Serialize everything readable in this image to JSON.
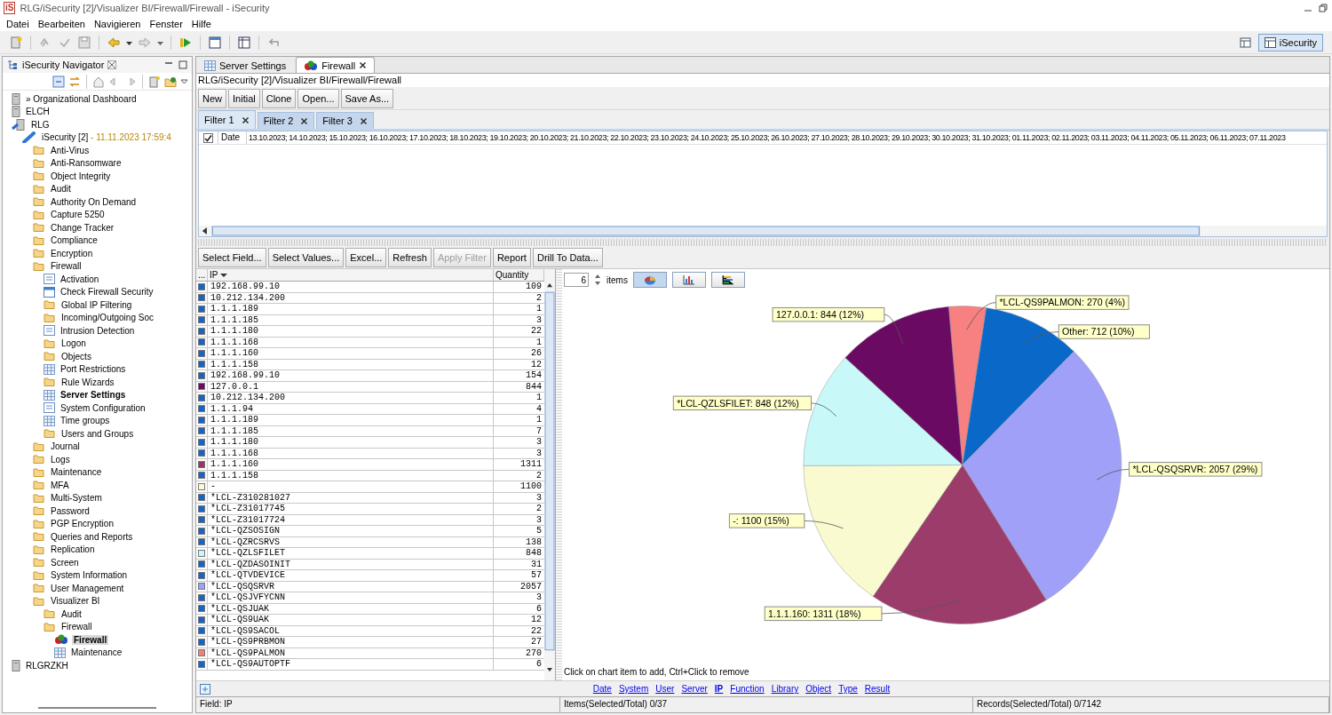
{
  "window": {
    "logo": "iS",
    "title": "RLG/iSecurity [2]/Visualizer BI/Firewall/Firewall - iSecurity"
  },
  "menu": [
    "Datei",
    "Bearbeiten",
    "Navigieren",
    "Fenster",
    "Hilfe"
  ],
  "perspective": {
    "label": "iSecurity",
    "selected": true
  },
  "navigator": {
    "title": "iSecurity Navigator",
    "tree": [
      {
        "label": "» Organizational Dashboard",
        "kind": "server",
        "selected": false,
        "open": false
      },
      {
        "label": "ELCH",
        "kind": "server",
        "selected": false,
        "open": false
      },
      {
        "label": "RLG",
        "kind": "system",
        "selected": false,
        "open": false,
        "children": [
          {
            "label": "iSecurity [2]",
            "detail": " - 11.11.2023 17:59:4",
            "kind": "plug",
            "selected": false,
            "open": false,
            "children": [
              {
                "label": "Anti-Virus",
                "kind": "folder",
                "selected": false,
                "open": false
              },
              {
                "label": "Anti-Ransomware",
                "kind": "folder",
                "selected": false,
                "open": false
              },
              {
                "label": "Object Integrity",
                "kind": "folder",
                "selected": false,
                "open": false
              },
              {
                "label": "Audit",
                "kind": "folder",
                "selected": false,
                "open": false
              },
              {
                "label": "Authority On Demand",
                "kind": "folder",
                "selected": false,
                "open": false
              },
              {
                "label": "Capture 5250",
                "kind": "folder",
                "selected": false,
                "open": false
              },
              {
                "label": "Change Tracker",
                "kind": "folder",
                "selected": false,
                "open": false
              },
              {
                "label": "Compliance",
                "kind": "folder",
                "selected": false,
                "open": false
              },
              {
                "label": "Encryption",
                "kind": "folder",
                "selected": false,
                "open": false
              },
              {
                "label": "Firewall",
                "kind": "folder",
                "selected": false,
                "open": false,
                "children": [
                  {
                    "label": "Activation",
                    "kind": "form",
                    "selected": false,
                    "open": false
                  },
                  {
                    "label": "Check Firewall Security",
                    "kind": "window",
                    "selected": false,
                    "open": false
                  },
                  {
                    "label": "Global IP Filtering",
                    "kind": "folder",
                    "selected": false,
                    "open": false
                  },
                  {
                    "label": "Incoming/Outgoing Soc",
                    "kind": "folder",
                    "selected": false,
                    "open": false
                  },
                  {
                    "label": "Intrusion Detection",
                    "kind": "form",
                    "selected": false,
                    "open": false
                  },
                  {
                    "label": "Logon",
                    "kind": "folder",
                    "selected": false,
                    "open": false
                  },
                  {
                    "label": "Objects",
                    "kind": "folder",
                    "selected": false,
                    "open": false
                  },
                  {
                    "label": "Port Restrictions",
                    "kind": "table",
                    "selected": false,
                    "open": false
                  },
                  {
                    "label": "Rule Wizards",
                    "kind": "folder",
                    "selected": false,
                    "open": false
                  },
                  {
                    "label": "Server Settings",
                    "kind": "table",
                    "selected": false,
                    "open": true
                  },
                  {
                    "label": "System Configuration",
                    "kind": "form",
                    "selected": false,
                    "open": false
                  },
                  {
                    "label": "Time groups",
                    "kind": "table",
                    "selected": false,
                    "open": false
                  },
                  {
                    "label": "Users and Groups",
                    "kind": "folder",
                    "selected": false,
                    "open": false
                  }
                ]
              },
              {
                "label": "Journal",
                "kind": "folder",
                "selected": false,
                "open": false
              },
              {
                "label": "Logs",
                "kind": "folder",
                "selected": false,
                "open": false
              },
              {
                "label": "Maintenance",
                "kind": "folder",
                "selected": false,
                "open": false
              },
              {
                "label": "MFA",
                "kind": "folder",
                "selected": false,
                "open": false
              },
              {
                "label": "Multi-System",
                "kind": "folder",
                "selected": false,
                "open": false
              },
              {
                "label": "Password",
                "kind": "folder",
                "selected": false,
                "open": false
              },
              {
                "label": "PGP Encryption",
                "kind": "folder",
                "selected": false,
                "open": false
              },
              {
                "label": "Queries and Reports",
                "kind": "folder",
                "selected": false,
                "open": false
              },
              {
                "label": "Replication",
                "kind": "folder",
                "selected": false,
                "open": false
              },
              {
                "label": "Screen",
                "kind": "folder",
                "selected": false,
                "open": false
              },
              {
                "label": "System Information",
                "kind": "folder",
                "selected": false,
                "open": false
              },
              {
                "label": "User Management",
                "kind": "folder",
                "selected": false,
                "open": false
              },
              {
                "label": "Visualizer BI",
                "kind": "folder",
                "selected": false,
                "open": false,
                "children": [
                  {
                    "label": "Audit",
                    "kind": "folder",
                    "selected": false,
                    "open": false
                  },
                  {
                    "label": "Firewall",
                    "kind": "folder",
                    "selected": false,
                    "open": false,
                    "children": [
                      {
                        "label": "Firewall",
                        "kind": "chart",
                        "selected": true,
                        "open": true
                      },
                      {
                        "label": "Maintenance",
                        "kind": "table",
                        "selected": false,
                        "open": false
                      }
                    ]
                  }
                ]
              }
            ]
          }
        ]
      },
      {
        "label": "RLGRZKH",
        "kind": "server",
        "selected": false,
        "open": false
      }
    ]
  },
  "editor": {
    "tabs": [
      {
        "label": "Server Settings",
        "kind": "table",
        "selected": false,
        "closable": false
      },
      {
        "label": "Firewall",
        "kind": "chart",
        "selected": true,
        "closable": true
      }
    ],
    "breadcrumb": "RLG/iSecurity [2]/Visualizer BI/Firewall/Firewall",
    "buttons": [
      "New",
      "Initial",
      "Clone",
      "Open...",
      "Save As..."
    ],
    "filter_tabs": [
      {
        "label": "Filter 1",
        "selected": true
      },
      {
        "label": "Filter 2",
        "selected": false
      },
      {
        "label": "Filter 3",
        "selected": false
      }
    ],
    "filters": [
      {
        "checked": true,
        "field": "Date",
        "values": "13.10.2023; 14.10.2023; 15.10.2023; 16.10.2023; 17.10.2023; 18.10.2023; 19.10.2023; 20.10.2023; 21.10.2023; 22.10.2023; 23.10.2023; 24.10.2023; 25.10.2023; 26.10.2023; 27.10.2023; 28.10.2023; 29.10.2023; 30.10.2023; 31.10.2023; 01.11.2023; 02.11.2023; 03.11.2023; 04.11.2023; 05.11.2023; 06.11.2023; 07.11.2023"
      }
    ],
    "actions": [
      {
        "label": "Select Field...",
        "disabled": false
      },
      {
        "label": "Select Values...",
        "disabled": false
      },
      {
        "label": "Excel...",
        "disabled": false
      },
      {
        "label": "Refresh",
        "disabled": false
      },
      {
        "label": "Apply Filter",
        "disabled": true
      },
      {
        "label": "Report",
        "disabled": false
      },
      {
        "label": "Drill To Data...",
        "disabled": false
      }
    ],
    "table": {
      "columns": [
        "...",
        "IP",
        "Quantity"
      ],
      "rows": [
        {
          "ip": "192.168.99.10",
          "quantity": "109",
          "color": "#1565c8"
        },
        {
          "ip": "10.212.134.200",
          "quantity": "2",
          "color": "#1565c8"
        },
        {
          "ip": "1.1.1.189",
          "quantity": "1",
          "color": "#1565c8"
        },
        {
          "ip": "1.1.1.185",
          "quantity": "3",
          "color": "#1565c8"
        },
        {
          "ip": "1.1.1.180",
          "quantity": "22",
          "color": "#1565c8"
        },
        {
          "ip": "1.1.1.168",
          "quantity": "1",
          "color": "#1565c8"
        },
        {
          "ip": "1.1.1.160",
          "quantity": "26",
          "color": "#1565c8"
        },
        {
          "ip": "1.1.1.158",
          "quantity": "12",
          "color": "#1565c8"
        },
        {
          "ip": "192.168.99.10",
          "quantity": "154",
          "color": "#1565c8"
        },
        {
          "ip": "127.0.0.1",
          "quantity": "844",
          "color": "#6a0a62"
        },
        {
          "ip": "10.212.134.200",
          "quantity": "1",
          "color": "#1565c8"
        },
        {
          "ip": "1.1.1.94",
          "quantity": "4",
          "color": "#1565c8"
        },
        {
          "ip": "1.1.1.189",
          "quantity": "1",
          "color": "#1565c8"
        },
        {
          "ip": "1.1.1.185",
          "quantity": "7",
          "color": "#1565c8"
        },
        {
          "ip": "1.1.1.180",
          "quantity": "3",
          "color": "#1565c8"
        },
        {
          "ip": "1.1.1.168",
          "quantity": "3",
          "color": "#1565c8"
        },
        {
          "ip": "1.1.1.160",
          "quantity": "1311",
          "color": "#9c3366"
        },
        {
          "ip": "1.1.1.158",
          "quantity": "2",
          "color": "#1565c8"
        },
        {
          "ip": "-",
          "quantity": "1100",
          "color": "#fafad2"
        },
        {
          "ip": "*LCL-Z310281027",
          "quantity": "3",
          "color": "#1565c8"
        },
        {
          "ip": "*LCL-Z31017745",
          "quantity": "2",
          "color": "#1565c8"
        },
        {
          "ip": "*LCL-Z31017724",
          "quantity": "3",
          "color": "#1565c8"
        },
        {
          "ip": "*LCL-QZSOSIGN",
          "quantity": "5",
          "color": "#1565c8"
        },
        {
          "ip": "*LCL-QZRCSRVS",
          "quantity": "138",
          "color": "#1565c8"
        },
        {
          "ip": "*LCL-QZLSFILET",
          "quantity": "848",
          "color": "#c8f8f8"
        },
        {
          "ip": "*LCL-QZDASOINIT",
          "quantity": "31",
          "color": "#1565c8"
        },
        {
          "ip": "*LCL-QTVDEVICE",
          "quantity": "57",
          "color": "#1565c8"
        },
        {
          "ip": "*LCL-QSQSRVR",
          "quantity": "2057",
          "color": "#a0a0f8"
        },
        {
          "ip": "*LCL-QSJVFYCNN",
          "quantity": "3",
          "color": "#1565c8"
        },
        {
          "ip": "*LCL-QSJUAK",
          "quantity": "6",
          "color": "#1565c8"
        },
        {
          "ip": "*LCL-QS9UAK",
          "quantity": "12",
          "color": "#1565c8"
        },
        {
          "ip": "*LCL-QS9SACOL",
          "quantity": "22",
          "color": "#1565c8"
        },
        {
          "ip": "*LCL-QS9PRBMON",
          "quantity": "27",
          "color": "#1565c8"
        },
        {
          "ip": "*LCL-QS9PALMON",
          "quantity": "270",
          "color": "#f08080"
        },
        {
          "ip": "*LCL-QS9AUTOPTF",
          "quantity": "6",
          "color": "#1565c8"
        }
      ]
    },
    "chart_toolbar": {
      "count": "6",
      "unit": "items",
      "views": [
        {
          "kind": "pie",
          "selected": true
        },
        {
          "kind": "bar",
          "selected": false
        },
        {
          "kind": "hbar",
          "selected": false
        }
      ]
    },
    "chart_data": {
      "type": "pie",
      "values": [
        270,
        712,
        2057,
        1311,
        1100,
        848,
        844
      ],
      "colors": [
        "#f78080",
        "#0a68c8",
        "#a0a0f8",
        "#9c3c6a",
        "#fafad0",
        "#c8f8f8",
        "#6a0a62"
      ],
      "value_labels": [
        "*LCL-QS9PALMON: 270 (4%)",
        "Other: 712 (10%)",
        "*LCL-QSQSRVR: 2057 (29%)",
        "1.1.1.160: 1311 (18%)",
        "-: 1100 (15%)",
        "*LCL-QZLSFILET: 848 (12%)",
        "127.0.0.1: 844 (12%)"
      ]
    },
    "hint": "Click on chart item to add, Ctrl+Click to remove",
    "fields": [
      {
        "label": "Date",
        "selected": false
      },
      {
        "label": "System",
        "selected": false
      },
      {
        "label": "User",
        "selected": false
      },
      {
        "label": "Server",
        "selected": false
      },
      {
        "label": "IP",
        "selected": true
      },
      {
        "label": "Function",
        "selected": false
      },
      {
        "label": "Library",
        "selected": false
      },
      {
        "label": "Object",
        "selected": false
      },
      {
        "label": "Type",
        "selected": false
      },
      {
        "label": "Result",
        "selected": false
      }
    ]
  },
  "status_bar": [
    "Field: IP",
    "Items(Selected/Total) 0/37",
    "Records(Selected/Total) 0/7142"
  ]
}
